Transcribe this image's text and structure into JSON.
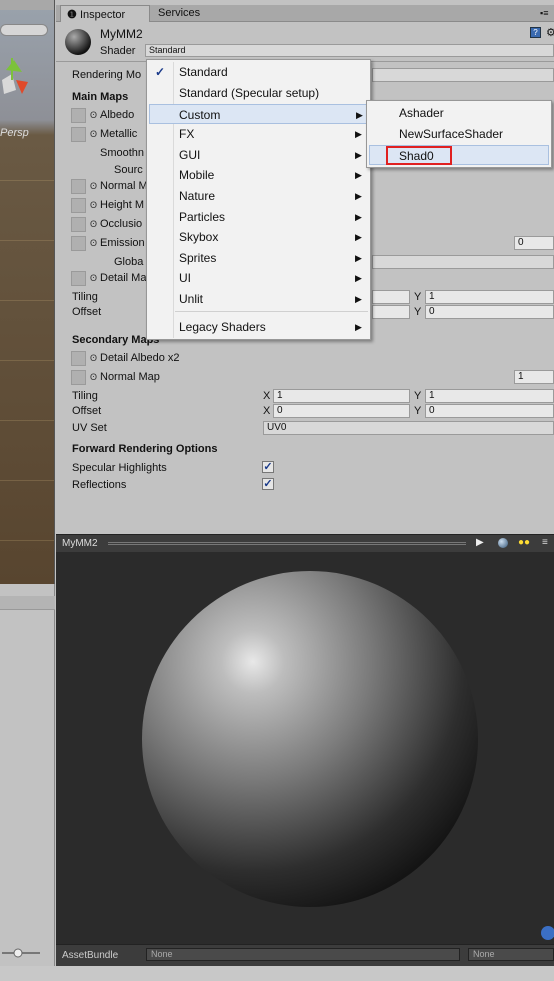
{
  "tabs": {
    "inspector": "Inspector",
    "services": "Services"
  },
  "scene": {
    "persp_label": "Persp"
  },
  "material": {
    "name": "MyMM2",
    "shader_label": "Shader",
    "shader_value": "Standard"
  },
  "rendering_mode_label": "Rendering Mo",
  "main_maps": {
    "heading": "Main Maps",
    "albedo": "Albedo",
    "metallic": "Metallic",
    "smoothness": "Smoothn",
    "source": "Sourc",
    "normal_map": "Normal M",
    "height_map": "Height M",
    "occlusion": "Occlusio",
    "emission": "Emission",
    "emission_value": "0",
    "global": "Globa",
    "detail_mask": "Detail Ma",
    "tiling": "Tiling",
    "offset": "Offset",
    "tiling_y": "1",
    "offset_y": "0",
    "x_axis": "X",
    "y_axis": "Y"
  },
  "secondary_maps": {
    "heading": "Secondary Maps",
    "detail_albedo": "Detail Albedo x2",
    "normal_map": "Normal Map",
    "normal_value": "1",
    "tiling": "Tiling",
    "offset": "Offset",
    "tiling_x": "1",
    "tiling_y": "1",
    "offset_x": "0",
    "offset_y": "0",
    "uv_set": "UV Set",
    "uv_set_value": "UV0",
    "x_axis": "X",
    "y_axis": "Y"
  },
  "forward_rendering": {
    "heading": "Forward Rendering Options",
    "specular_highlights": "Specular Highlights",
    "reflections": "Reflections",
    "check": "✓"
  },
  "shader_menu": {
    "items": [
      "Standard",
      "Standard (Specular setup)",
      "Custom",
      "FX",
      "GUI",
      "Mobile",
      "Nature",
      "Particles",
      "Skybox",
      "Sprites",
      "UI",
      "Unlit",
      "Legacy Shaders"
    ],
    "checked_item": "Standard",
    "highlighted_item": "Custom",
    "checkmark": "✓",
    "submenu_arrow": "▶"
  },
  "custom_submenu": {
    "items": [
      "Ashader",
      "NewSurfaceShader",
      "Shad0"
    ],
    "highlighted_item": "Shad0"
  },
  "preview": {
    "title": "MyMM2",
    "asset_bundle_label": "AssetBundle",
    "bundle_value": "None",
    "variant_value": "None"
  },
  "colors": {
    "highlight_border": "#e02020",
    "menu_highlight": "#dce6f4",
    "check_blue": "#1a3a8a"
  }
}
